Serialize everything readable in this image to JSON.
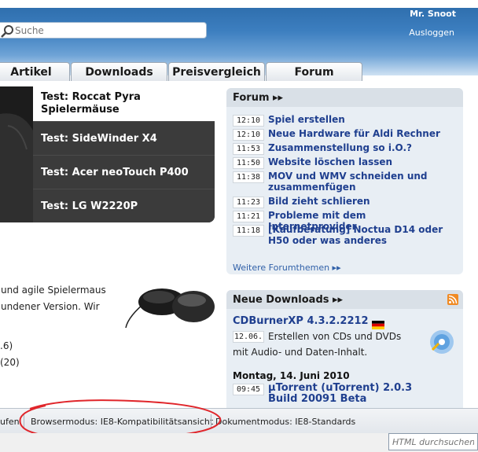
{
  "header": {
    "user_name": "Mr. Snoot",
    "logout": "Ausloggen",
    "search_placeholder": "Suche",
    "tabs": [
      "Artikel",
      "Downloads",
      "Preisvergleich",
      "Forum"
    ]
  },
  "slider": {
    "items": [
      "Test: Roccat Pyra Spielermäuse",
      "Test: SideWinder X4",
      "Test: Acer neoTouch P400",
      "Test: LG W2220P"
    ]
  },
  "article": {
    "line1": "und agile Spielermaus",
    "line2": "undener Version. Wir",
    "line3": ".6)",
    "line4": "(20)"
  },
  "forum": {
    "title": "Forum ▸▸",
    "threads": [
      {
        "time": "12:10",
        "title": "Spiel erstellen"
      },
      {
        "time": "12:10",
        "title": "Neue Hardware für Aldi Rechner"
      },
      {
        "time": "11:53",
        "title": "Zusammenstellung so i.O.?"
      },
      {
        "time": "11:50",
        "title": "Website löschen lassen"
      },
      {
        "time": "11:38",
        "title": "MOV und WMV schneiden und zusammenfügen"
      },
      {
        "time": "11:23",
        "title": "Bild zieht schlieren"
      },
      {
        "time": "11:21",
        "title": "Probleme mit dem Internetprovider"
      },
      {
        "time": "11:18",
        "title": "[Kaufberatung] Noctua D14 oder H50 oder was anderes"
      }
    ],
    "more": "Weitere Forumthemen ▸▸"
  },
  "downloads": {
    "title": "Neue Downloads ▸▸",
    "item1_title": "CDBurnerXP 4.3.2.2212",
    "item1_date": "12.06.",
    "item1_desc1": "Erstellen von CDs und DVDs",
    "item1_desc2": "mit Audio- und Daten-Inhalt.",
    "day_heading": "Montag, 14. Juni 2010",
    "item2_time": "09:45",
    "item2_title": "µTorrent (uTorrent) 2.0.3 Build 20091 Beta"
  },
  "statusbar": {
    "left_fragment": "ufen",
    "browser_mode": "Browsermodus: IE8-Kompatibilitätsansicht",
    "document_mode": "Dokumentmodus: IE8-Standards"
  },
  "findbar": {
    "placeholder": "HTML durchsuchen"
  },
  "colors": {
    "header_blue": "#3d7fc0",
    "link_blue": "#1f3f8f",
    "highlight_red": "#e0262b"
  }
}
